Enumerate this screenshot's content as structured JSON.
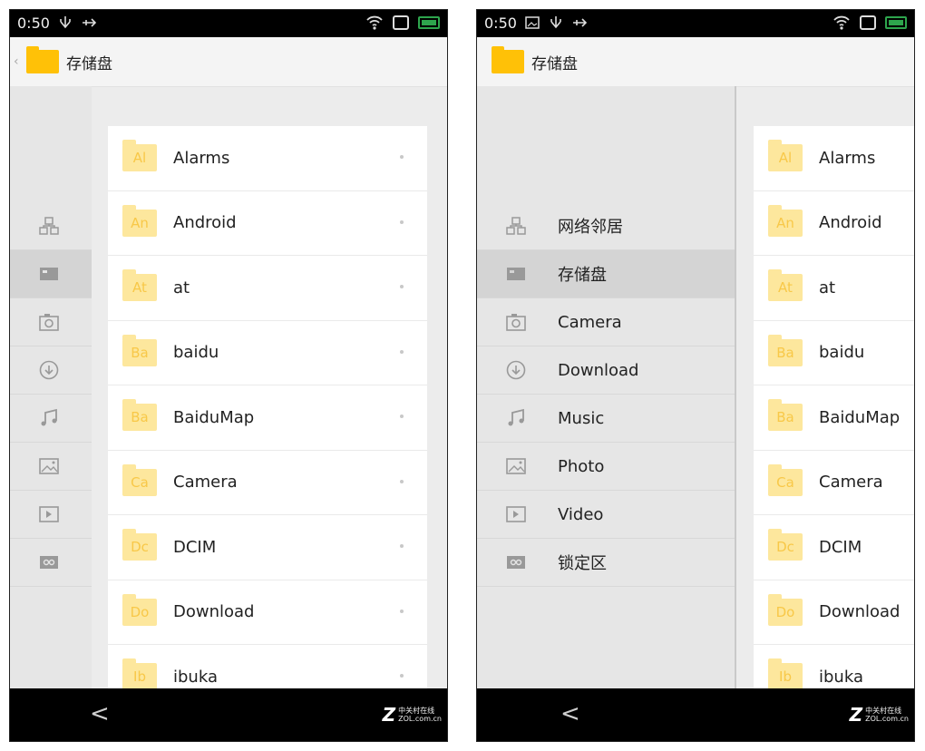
{
  "status": {
    "time": "0:50"
  },
  "title": "存储盘",
  "sidebar": {
    "items": [
      {
        "label": "网络邻居",
        "icon": "network-icon"
      },
      {
        "label": "存储盘",
        "icon": "storage-icon"
      },
      {
        "label": "Camera",
        "icon": "camera-icon"
      },
      {
        "label": "Download",
        "icon": "download-icon"
      },
      {
        "label": "Music",
        "icon": "music-icon"
      },
      {
        "label": "Photo",
        "icon": "photo-icon"
      },
      {
        "label": "Video",
        "icon": "video-icon"
      },
      {
        "label": "锁定区",
        "icon": "lock-zone-icon"
      }
    ]
  },
  "files": [
    {
      "abbr": "Al",
      "name": "Alarms"
    },
    {
      "abbr": "An",
      "name": "Android"
    },
    {
      "abbr": "At",
      "name": "at"
    },
    {
      "abbr": "Ba",
      "name": "baidu"
    },
    {
      "abbr": "Ba",
      "name": "BaiduMap"
    },
    {
      "abbr": "Ca",
      "name": "Camera"
    },
    {
      "abbr": "Dc",
      "name": "DCIM"
    },
    {
      "abbr": "Do",
      "name": "Download"
    },
    {
      "abbr": "Ib",
      "name": "ibuka"
    }
  ],
  "nav": {
    "back": "<"
  },
  "logo": {
    "mark": "Z",
    "cn": "中关村在线",
    "en": "ZOL.com.cn"
  },
  "colors": {
    "folder": "#ffc107",
    "folder_light": "#fde79d",
    "battery": "#2ea54d"
  }
}
